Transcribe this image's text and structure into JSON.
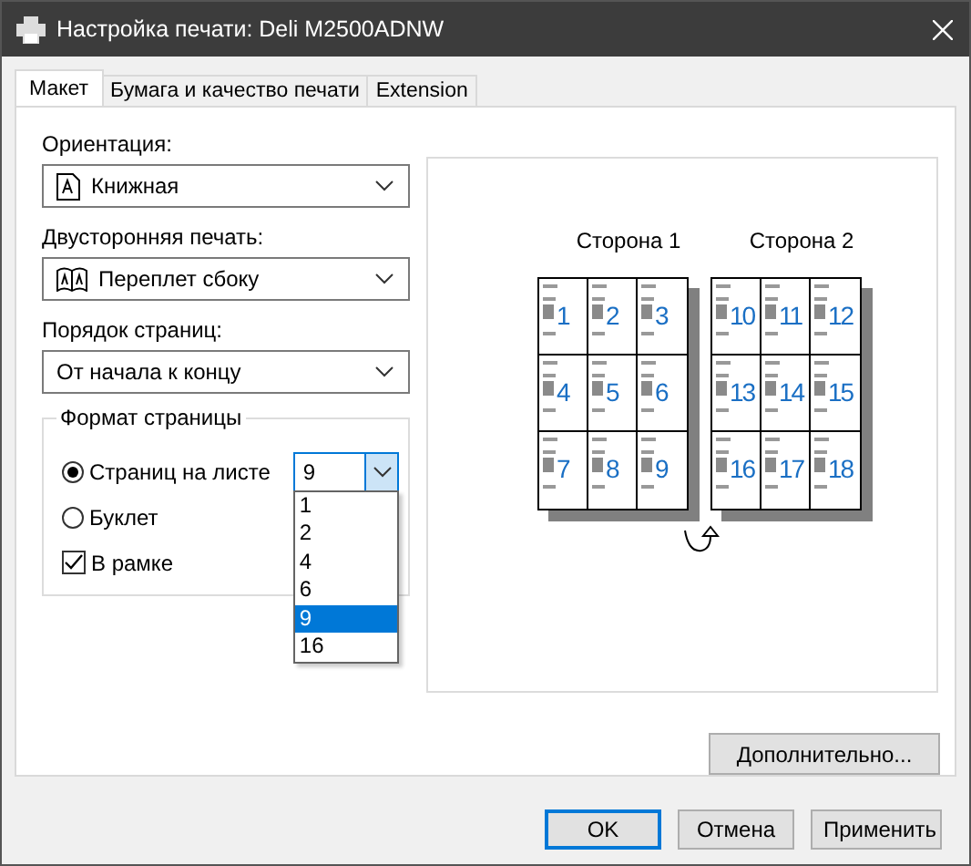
{
  "window": {
    "title": "Настройка печати: Deli M2500ADNW"
  },
  "tabs": [
    {
      "label": "Макет",
      "selected": true
    },
    {
      "label": "Бумага и качество печати",
      "selected": false
    },
    {
      "label": "Extension",
      "selected": false
    }
  ],
  "fields": [
    {
      "kind": "orientation",
      "label": "Ориентация:",
      "value": "Книжная"
    },
    {
      "kind": "duplex",
      "label": "Двусторонняя печать:",
      "value": "Переплет сбоку"
    },
    {
      "kind": "plain",
      "label": "Порядок страниц:",
      "value": "От начала к концу"
    }
  ],
  "page_format": {
    "title": "Формат страницы",
    "options": [
      {
        "kind": "radio",
        "label": "Страниц на листе",
        "selected": true
      },
      {
        "kind": "radio",
        "label": "Буклет",
        "selected": false
      },
      {
        "kind": "checkbox",
        "label": "В рамке",
        "checked": true
      }
    ],
    "pages_per_sheet": {
      "value": "9",
      "expanded": true,
      "options": [
        {
          "label": "1",
          "selected": false
        },
        {
          "label": "2",
          "selected": false
        },
        {
          "label": "4",
          "selected": false
        },
        {
          "label": "6",
          "selected": false
        },
        {
          "label": "9",
          "selected": true
        },
        {
          "label": "16",
          "selected": false
        }
      ]
    }
  },
  "preview": {
    "sides": [
      {
        "label": "Сторона 1",
        "pages": [
          "1",
          "2",
          "3",
          "4",
          "5",
          "6",
          "7",
          "8",
          "9"
        ]
      },
      {
        "label": "Сторона 2",
        "pages": [
          "10",
          "11",
          "12",
          "13",
          "14",
          "15",
          "16",
          "17",
          "18"
        ]
      }
    ]
  },
  "advanced_button": "Дополнительно...",
  "buttons": [
    {
      "label": "OK",
      "default": true
    },
    {
      "label": "Отмена",
      "default": false
    },
    {
      "label": "Применить",
      "default": false
    }
  ]
}
